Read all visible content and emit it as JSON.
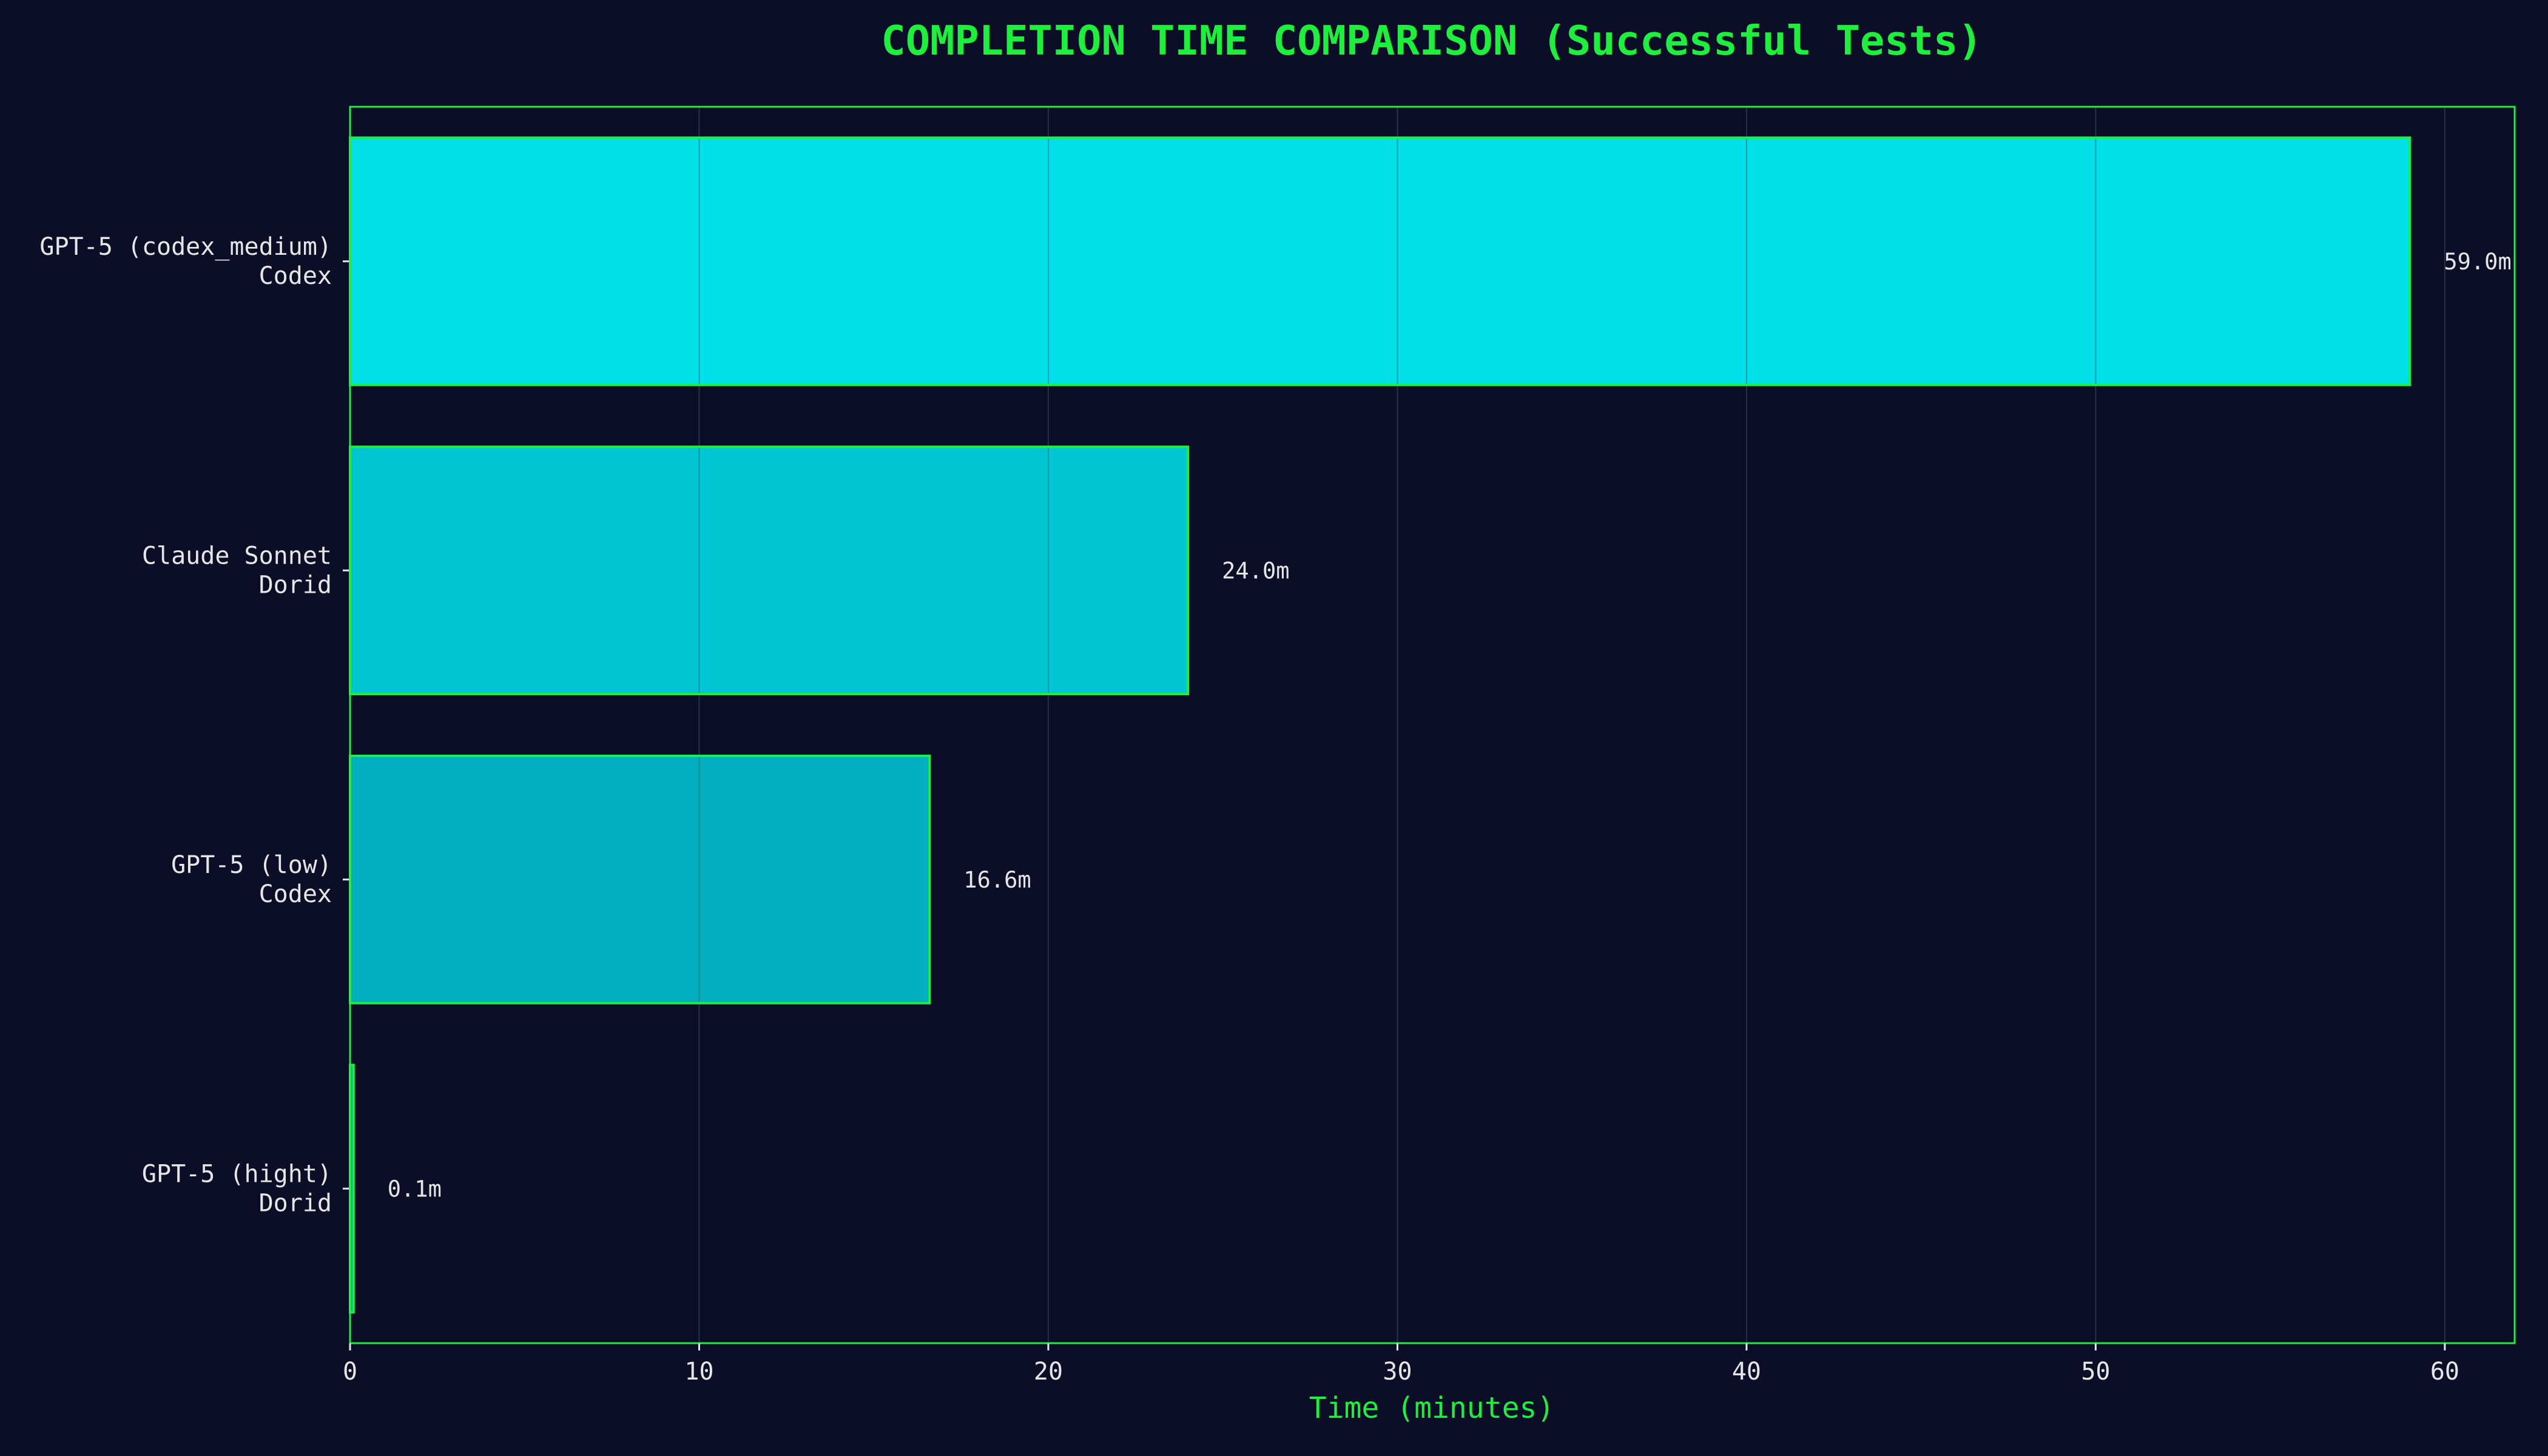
{
  "chart_data": {
    "type": "bar",
    "orientation": "horizontal",
    "title": "COMPLETION TIME COMPARISON (Successful Tests)",
    "xlabel": "Time (minutes)",
    "ylabel": "",
    "xlim": [
      0,
      62
    ],
    "xticks": [
      0,
      10,
      20,
      30,
      40,
      50,
      60
    ],
    "grid": "x",
    "categories": [
      [
        "GPT-5 (codex_medium)",
        "Codex"
      ],
      [
        "Claude Sonnet",
        "Dorid"
      ],
      [
        "GPT-5 (low)",
        "Codex"
      ],
      [
        "GPT-5 (hight)",
        "Dorid"
      ]
    ],
    "values": [
      59.0,
      24.0,
      16.6,
      0.1
    ],
    "value_labels": [
      "59.0m",
      "24.0m",
      "16.6m",
      "0.1m"
    ],
    "bar_colors": [
      "#00e0e8",
      "#00c6d4",
      "#00aebe",
      "#0096a8"
    ]
  },
  "colors": {
    "background": "#0b0e26",
    "accent": "#1cf03c",
    "text": "#e6e6e6",
    "grid": "#2a2f45"
  }
}
